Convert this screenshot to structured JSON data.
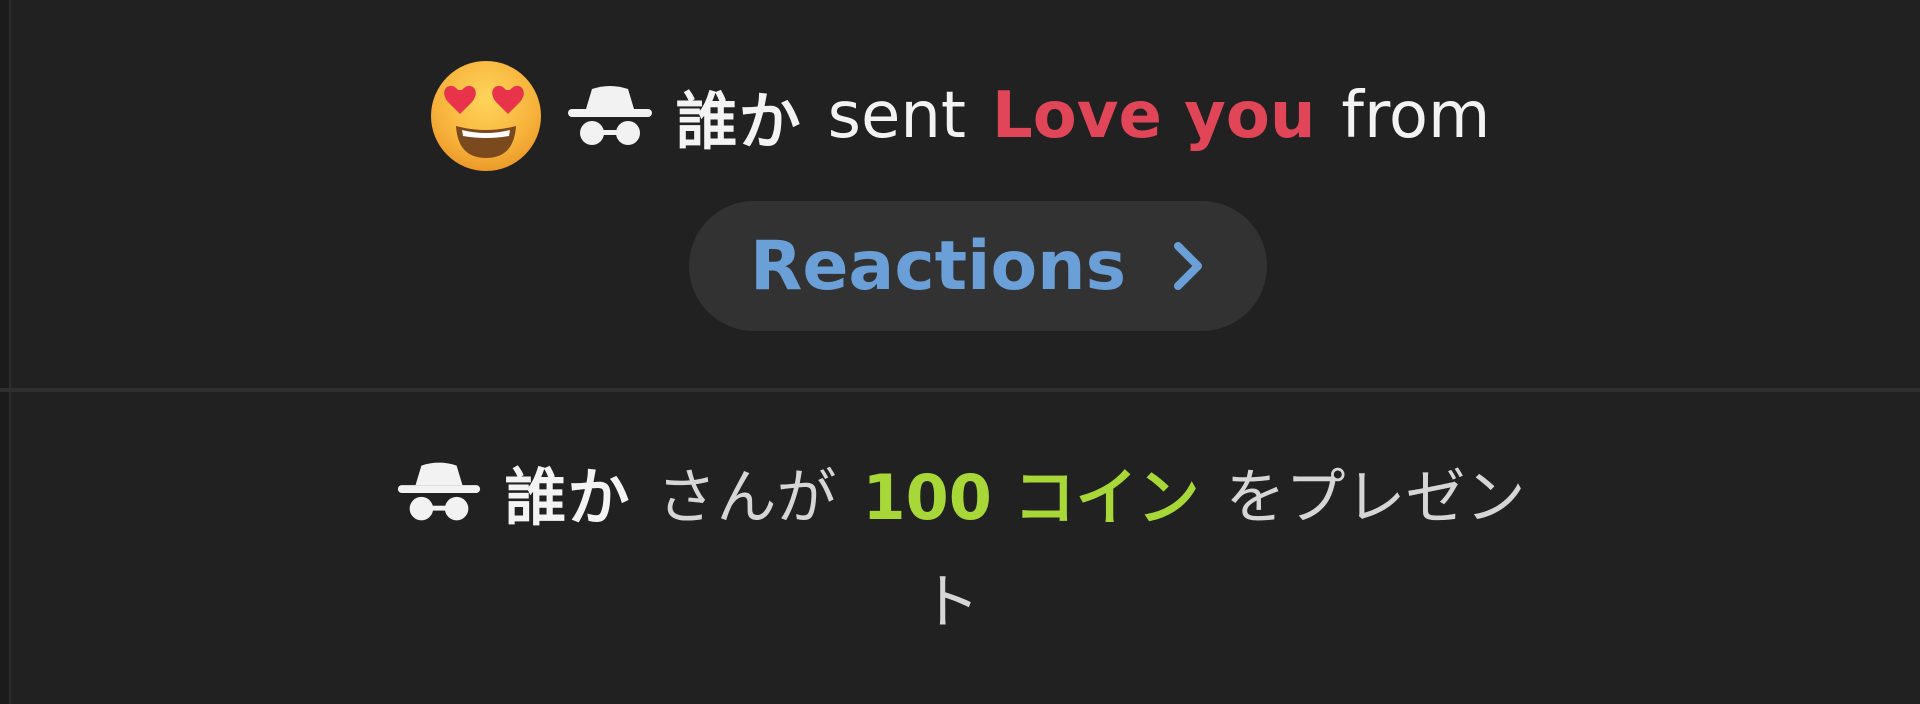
{
  "events": {
    "reaction": {
      "emoji_icon": "heart-eyes-face-icon",
      "user_icon": "spy-incognito-icon",
      "user_name": "誰か",
      "verb": "sent",
      "gift_name": "Love you",
      "preposition": "from",
      "link_label": "Reactions",
      "link_icon": "chevron-right-icon"
    },
    "coin_gift": {
      "user_icon": "spy-incognito-icon",
      "user_name": "誰か",
      "particle": "さんが",
      "amount_label": "100 コイン",
      "action_line1": "をプレゼン",
      "action_line2": "ト"
    }
  },
  "colors": {
    "background": "#212121",
    "divider": "#2f2f2f",
    "pill_background": "#323232",
    "gift_red": "#e04658",
    "link_blue": "#6a9fd8",
    "coin_green": "#a8d838",
    "text_white": "#f3f3f3"
  }
}
